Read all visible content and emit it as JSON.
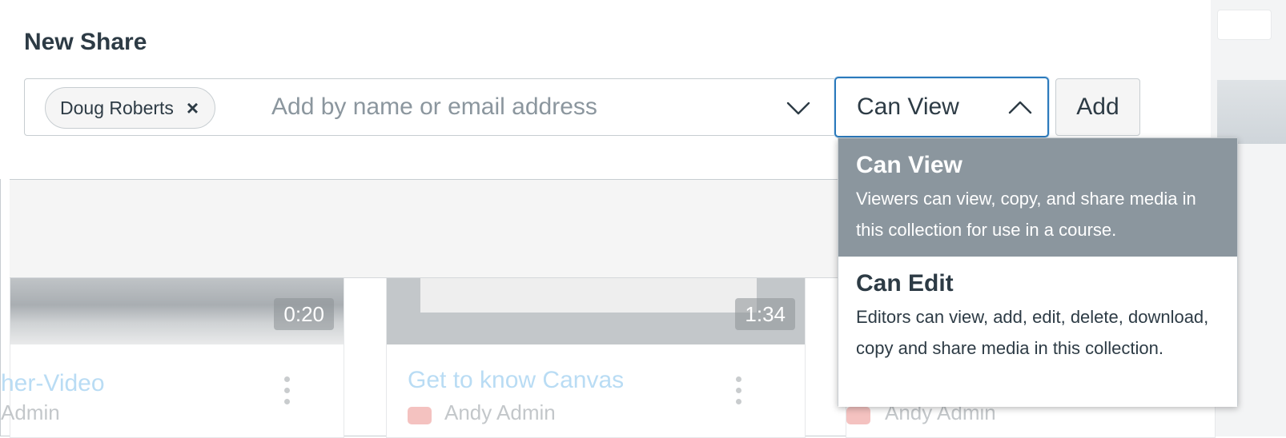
{
  "panel": {
    "title": "New Share",
    "recipient_tag": "Doug Roberts",
    "tag_remove_symbol": "×",
    "recipient_placeholder": "Add by name or email address",
    "permission_value": "Can View",
    "add_label": "Add"
  },
  "dropdown": {
    "options": [
      {
        "title": "Can View",
        "description": "Viewers can view, copy, and share media in this collection for use in a course.",
        "selected": true
      },
      {
        "title": "Can Edit",
        "description": "Editors can view, add, edit, delete, download, copy and share media in this collection.",
        "selected": false
      }
    ]
  },
  "background": {
    "cards": [
      {
        "title": "her-Video",
        "owner": "Admin",
        "duration": "0:20"
      },
      {
        "title": "Get to know Canvas",
        "owner": "Andy Admin",
        "duration": "1:34"
      },
      {
        "owner": "Andy Admin"
      }
    ]
  },
  "colors": {
    "accent": "#2b7abc",
    "selected_option_bg": "#8b969e",
    "text": "#2d3b45",
    "link_faded": "#b9dcf4"
  },
  "icons": {
    "recipient_dropdown": "chevron-down-icon",
    "permission_dropdown": "chevron-up-icon",
    "tag_remove": "close-icon",
    "card_menu": "kebab-menu-icon",
    "source": "youtube-icon"
  }
}
